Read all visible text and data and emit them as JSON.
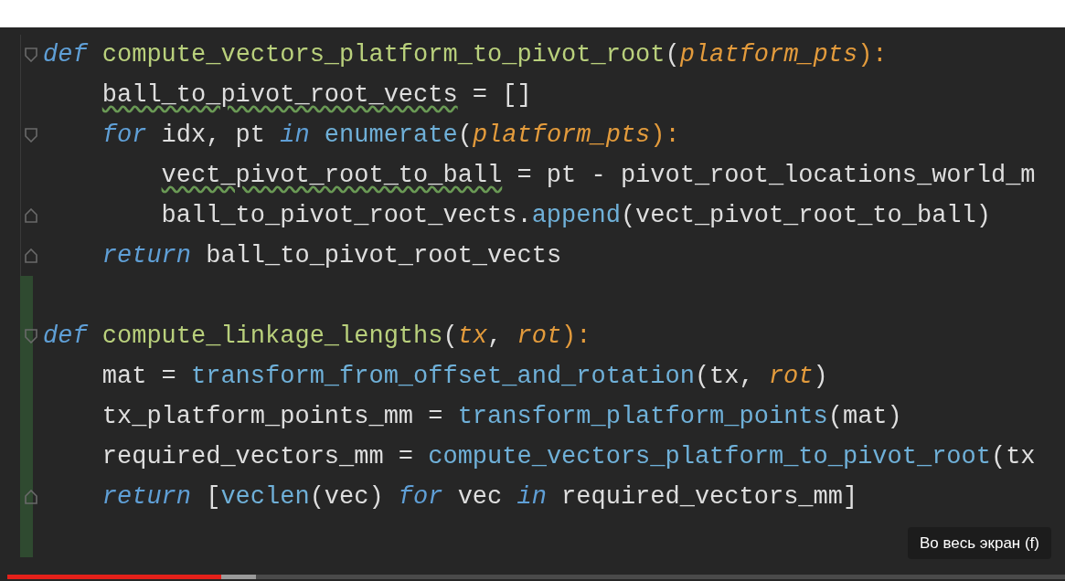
{
  "code_lines": [
    {
      "kind": "code",
      "fold_start": true,
      "fold_end": false,
      "changed": false,
      "tokens": [
        {
          "text": "def",
          "kind": "keyword"
        },
        {
          "text": " compute_vectors_platform_to_pivot_root",
          "kind": "defname"
        },
        {
          "text": "(",
          "kind": "plain"
        },
        {
          "text": "platform_pts",
          "kind": "param"
        },
        {
          "text": "):",
          "kind": "punct"
        }
      ],
      "children": [
        {
          "kind": "code",
          "fold_start": false,
          "fold_end": false,
          "changed": false,
          "tokens": [
            {
              "text": "ball_to_pivot_root_vects",
              "kind": "plain",
              "squiggle": true
            },
            {
              "text": " = []",
              "kind": "plain"
            }
          ]
        },
        {
          "kind": "code",
          "fold_start": true,
          "fold_end": false,
          "changed": false,
          "tokens": [
            {
              "text": "for",
              "kind": "keyword"
            },
            {
              "text": " idx, pt ",
              "kind": "plain"
            },
            {
              "text": "in",
              "kind": "keyword"
            },
            {
              "text": " enumerate",
              "kind": "call"
            },
            {
              "text": "(",
              "kind": "plain"
            },
            {
              "text": "platform_pts",
              "kind": "param"
            },
            {
              "text": "):",
              "kind": "punct"
            }
          ],
          "children": [
            {
              "kind": "code",
              "fold_start": false,
              "fold_end": false,
              "changed": false,
              "tokens": [
                {
                  "text": "vect_pivot_root_to_ball",
                  "kind": "plain",
                  "squiggle": true
                },
                {
                  "text": " = pt - pivot_root_locations_world_m",
                  "kind": "plain"
                }
              ]
            },
            {
              "kind": "code",
              "fold_start": false,
              "fold_end": true,
              "changed": false,
              "tokens": [
                {
                  "text": "ball_to_pivot_root_vects.",
                  "kind": "plain"
                },
                {
                  "text": "append",
                  "kind": "call"
                },
                {
                  "text": "(vect_pivot_root_to_ball)",
                  "kind": "plain"
                }
              ]
            }
          ]
        },
        {
          "kind": "code",
          "fold_start": false,
          "fold_end": true,
          "changed": false,
          "tokens": [
            {
              "text": "return",
              "kind": "keyword"
            },
            {
              "text": " ball_to_pivot_root_vects",
              "kind": "plain"
            }
          ]
        }
      ]
    },
    {
      "kind": "blank",
      "fold_start": false,
      "fold_end": false,
      "changed": true
    },
    {
      "kind": "code",
      "fold_start": true,
      "fold_end": false,
      "changed": true,
      "tokens": [
        {
          "text": "def",
          "kind": "keyword"
        },
        {
          "text": " compute_linkage_lengths",
          "kind": "defname"
        },
        {
          "text": "(",
          "kind": "plain"
        },
        {
          "text": "tx",
          "kind": "param"
        },
        {
          "text": ", ",
          "kind": "plain"
        },
        {
          "text": "rot",
          "kind": "param"
        },
        {
          "text": "):",
          "kind": "punct"
        }
      ],
      "children": [
        {
          "kind": "code",
          "fold_start": false,
          "fold_end": false,
          "changed": true,
          "tokens": [
            {
              "text": "mat = ",
              "kind": "plain"
            },
            {
              "text": "transform_from_offset_and_rotation",
              "kind": "call"
            },
            {
              "text": "(tx, ",
              "kind": "plain"
            },
            {
              "text": "rot",
              "kind": "param"
            },
            {
              "text": ")",
              "kind": "plain"
            }
          ]
        },
        {
          "kind": "code",
          "fold_start": false,
          "fold_end": false,
          "changed": true,
          "tokens": [
            {
              "text": "tx_platform_points_mm = ",
              "kind": "plain"
            },
            {
              "text": "transform_platform_points",
              "kind": "call"
            },
            {
              "text": "(mat)",
              "kind": "plain"
            }
          ]
        },
        {
          "kind": "code",
          "fold_start": false,
          "fold_end": false,
          "changed": true,
          "tokens": [
            {
              "text": "required_vectors_mm = ",
              "kind": "plain"
            },
            {
              "text": "compute_vectors_platform_to_pivot_root",
              "kind": "call"
            },
            {
              "text": "(tx",
              "kind": "plain"
            }
          ]
        },
        {
          "kind": "code",
          "fold_start": false,
          "fold_end": true,
          "changed": true,
          "tokens": [
            {
              "text": "return",
              "kind": "keyword"
            },
            {
              "text": " [",
              "kind": "plain"
            },
            {
              "text": "veclen",
              "kind": "call"
            },
            {
              "text": "(vec) ",
              "kind": "plain"
            },
            {
              "text": "for",
              "kind": "keyword"
            },
            {
              "text": " vec ",
              "kind": "plain"
            },
            {
              "text": "in",
              "kind": "keyword"
            },
            {
              "text": " required_vectors_mm]",
              "kind": "plain"
            }
          ]
        }
      ]
    },
    {
      "kind": "blank",
      "fold_start": false,
      "fold_end": false,
      "changed": true
    }
  ],
  "player": {
    "progress": {
      "level": 0.202
    },
    "tooltip": "Во весь экран (f)"
  }
}
